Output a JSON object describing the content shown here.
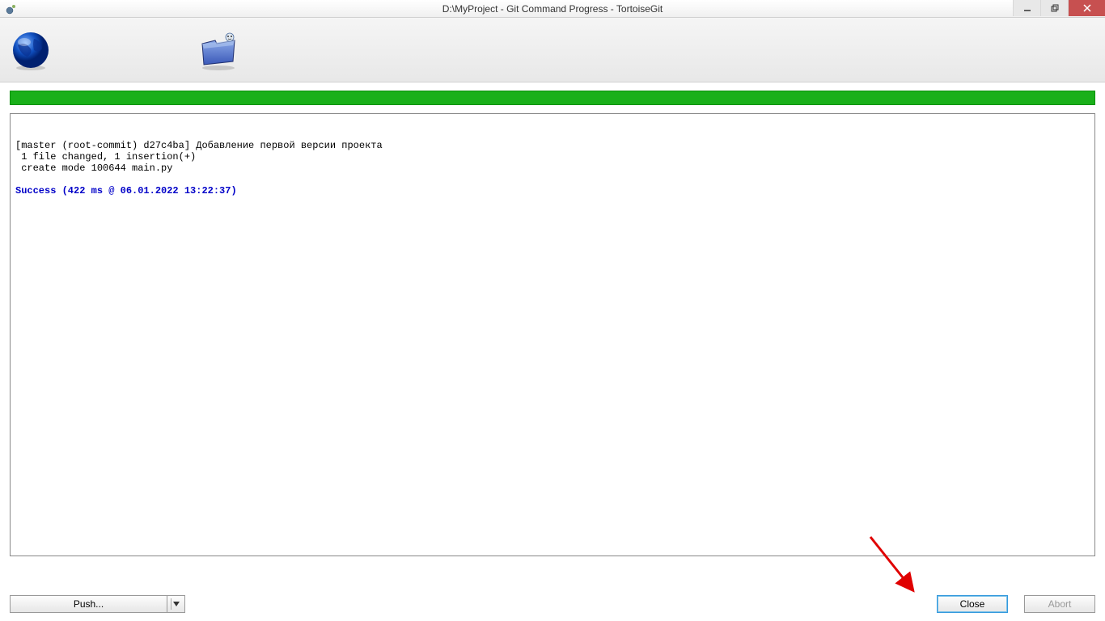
{
  "window": {
    "title": "D:\\MyProject - Git Command Progress - TortoiseGit"
  },
  "output": {
    "line1": "[master (root-commit) d27c4ba] Добавление первой версии проекта",
    "line2": " 1 file changed, 1 insertion(+)",
    "line3": " create mode 100644 main.py",
    "success": "Success (422 ms @ 06.01.2022 13:22:37)"
  },
  "buttons": {
    "push": "Push...",
    "close": "Close",
    "abort": "Abort"
  }
}
